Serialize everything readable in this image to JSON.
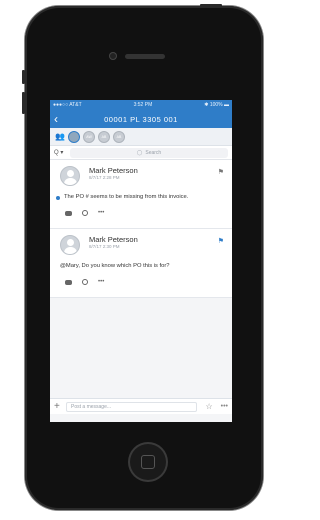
{
  "status": {
    "carrier": "●●●○○ AT&T",
    "time": "3:52 PM",
    "battery": "100%"
  },
  "header": {
    "title": "00001  PL  3305  001",
    "back_icon": "chevron-left"
  },
  "members": [
    "",
    "AW",
    "AB",
    "AB"
  ],
  "search": {
    "placeholder": "Search",
    "filter_label": "Q ▾"
  },
  "messages": [
    {
      "name": "Mark Peterson",
      "date": "8/7/17 2:28 PM",
      "text": "The PO # seems to be missing from this invoice.",
      "flag_color": "#777777",
      "unread": true
    },
    {
      "name": "Mark Peterson",
      "date": "8/7/17 2:30 PM",
      "text": "@Mary, Do you know which PO this is for?",
      "flag_color": "#2f7dc8",
      "unread": false
    }
  ],
  "composer": {
    "placeholder": "Post a message...",
    "more": "•••"
  },
  "colors": {
    "accent": "#2f7dc8"
  }
}
